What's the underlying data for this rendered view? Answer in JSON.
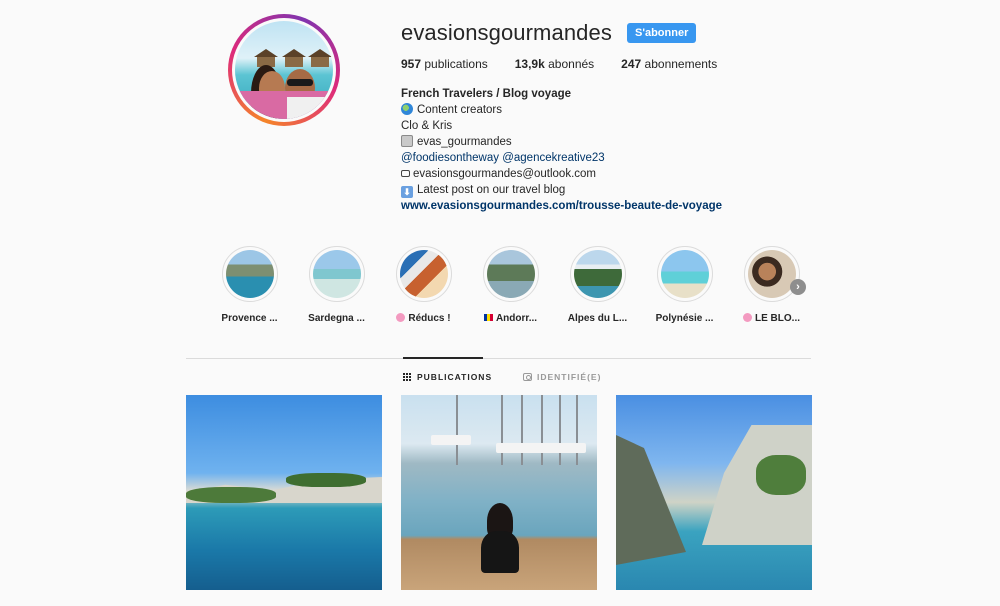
{
  "profile": {
    "username": "evasionsgourmandes",
    "follow_label": "S'abonner",
    "stats": [
      {
        "count": "957",
        "label": "publications"
      },
      {
        "count": "13,9k",
        "label": "abonnés"
      },
      {
        "count": "247",
        "label": "abonnements"
      }
    ],
    "bio": {
      "name": "French Travelers / Blog voyage",
      "line1": "Content creators",
      "line2": "Clo & Kris",
      "line3": "evas_gourmandes",
      "mention1": "@foodiesontheway",
      "mention2": "@agencekreative23",
      "email": "evasionsgourmandes@outlook.com",
      "line6": "Latest post on our travel blog",
      "link": "www.evasionsgourmandes.com/trousse-beaute-de-voyage"
    }
  },
  "highlights": [
    {
      "label": "Provence ..."
    },
    {
      "label": "Sardegna ..."
    },
    {
      "label": "Réducs !"
    },
    {
      "label": "Andorr..."
    },
    {
      "label": "Alpes du L..."
    },
    {
      "label": "Polynésie ..."
    },
    {
      "label": "LE BLO..."
    }
  ],
  "tabs": {
    "publications": "PUBLICATIONS",
    "tagged": "IDENTIFIÉ(E)"
  },
  "icons": {
    "next_arrow": "›",
    "down_arrow": "⬇"
  },
  "colors": {
    "follow_button": "#3897f0",
    "link": "#003569"
  }
}
